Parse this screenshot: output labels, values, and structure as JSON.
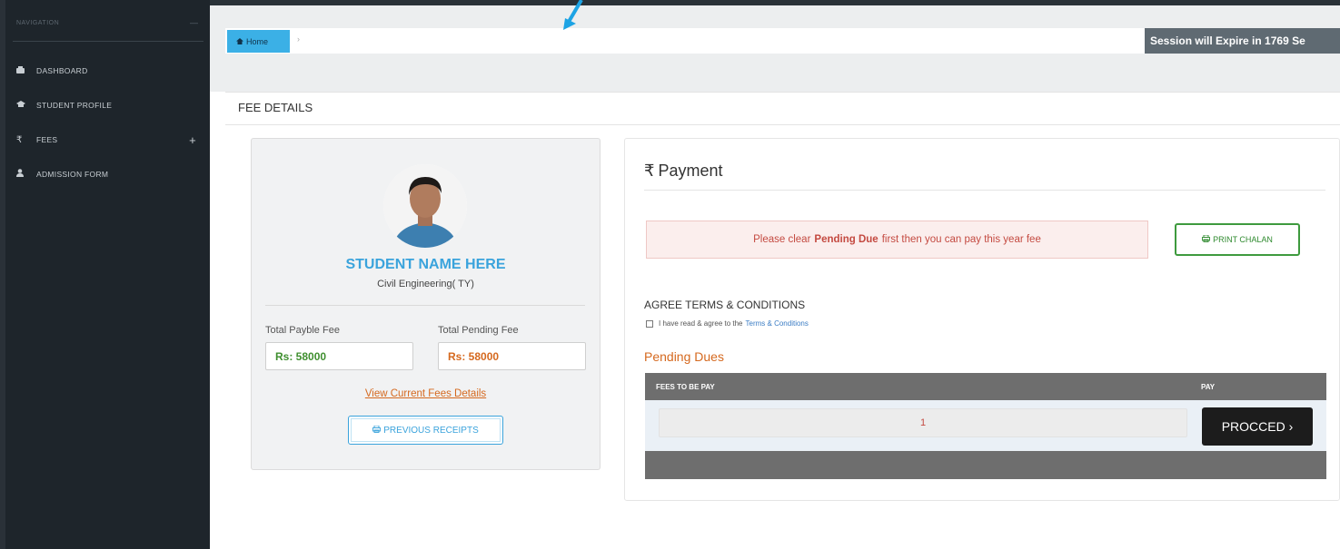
{
  "sidebar": {
    "header_label": "NAVIGATION",
    "header_dash": "—",
    "items": [
      {
        "label": "DASHBOARD",
        "icon": "dashboard-icon",
        "glyph": "⌂"
      },
      {
        "label": "STUDENT PROFILE",
        "icon": "graduation-cap-icon",
        "glyph": "🎓"
      },
      {
        "label": "FEES",
        "icon": "rupee-icon",
        "glyph": "₹",
        "expand": "+"
      },
      {
        "label": "ADMISSION FORM",
        "icon": "user-icon",
        "glyph": "👤"
      }
    ]
  },
  "breadcrumb": {
    "home_label": "Home",
    "separator": "›"
  },
  "session": {
    "text": "Session will Expire in 1769 Se"
  },
  "page": {
    "title": "FEE DETAILS"
  },
  "student": {
    "name": "STUDENT NAME HERE",
    "course": "Civil Engineering( TY)",
    "total_payable_label": "Total Payble Fee",
    "total_payable_value": "Rs: 58000",
    "total_pending_label": "Total Pending Fee",
    "total_pending_value": "Rs: 58000",
    "view_link": "View Current Fees Details",
    "prev_receipts": "PREVIOUS RECEIPTS"
  },
  "payment": {
    "title": "Payment",
    "currency_symbol": "₹",
    "alert_pre": "Please clear",
    "alert_bold": "Pending Due",
    "alert_post": "first then you can pay this year fee",
    "print_button": "PRINT CHALAN",
    "agree_title": "AGREE TERMS & CONDITIONS",
    "agree_text": "I have read & agree to the",
    "agree_link": "Terms & Conditions",
    "pending_title": "Pending Dues",
    "table_headers": [
      "FEES TO BE PAY",
      "PAY"
    ],
    "row_value": "1",
    "proceed_button": "PROCCED ›"
  },
  "colors": {
    "sidebar_bg": "#1e252b",
    "accent_blue": "#3bb0e6",
    "accent_orange": "#d5691f",
    "success_green": "#3e9a3e",
    "danger_red": "#c44a41"
  }
}
